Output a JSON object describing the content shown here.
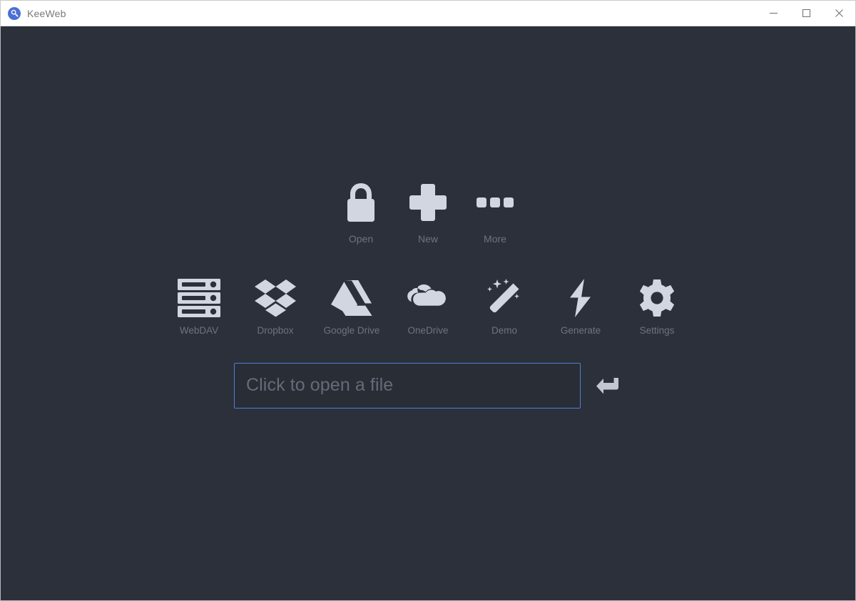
{
  "titlebar": {
    "app_icon": "keeweb-key-icon",
    "title": "KeeWeb",
    "controls": [
      {
        "name": "minimize",
        "icon": "minimize-icon",
        "label": "Minimize"
      },
      {
        "name": "maximize",
        "icon": "maximize-icon",
        "label": "Maximize"
      },
      {
        "name": "close",
        "icon": "close-icon",
        "label": "Close"
      }
    ]
  },
  "main": {
    "primary_actions": [
      {
        "icon": "lock-icon",
        "label": "Open"
      },
      {
        "icon": "plus-icon",
        "label": "New"
      },
      {
        "icon": "ellipsis-icon",
        "label": "More"
      }
    ],
    "storage_actions": [
      {
        "icon": "server-icon",
        "label": "WebDAV"
      },
      {
        "icon": "dropbox-icon",
        "label": "Dropbox"
      },
      {
        "icon": "google-drive-icon",
        "label": "Google Drive"
      },
      {
        "icon": "onedrive-icon",
        "label": "OneDrive"
      },
      {
        "icon": "magic-wand-icon",
        "label": "Demo"
      },
      {
        "icon": "lightning-bolt-icon",
        "label": "Generate"
      },
      {
        "icon": "gear-icon",
        "label": "Settings"
      }
    ],
    "file_input": {
      "placeholder": "Click to open a file",
      "value": "",
      "enter_icon": "enter-arrow-icon"
    }
  },
  "colors": {
    "app_background": "#2c303a",
    "icon": "#d2d6e0",
    "label": "#6e737e",
    "focus_border": "#4e7fd4",
    "titlebar_background": "#ffffff",
    "titlebar_text": "#7a7a7a",
    "brand": "#4a6fd4"
  }
}
